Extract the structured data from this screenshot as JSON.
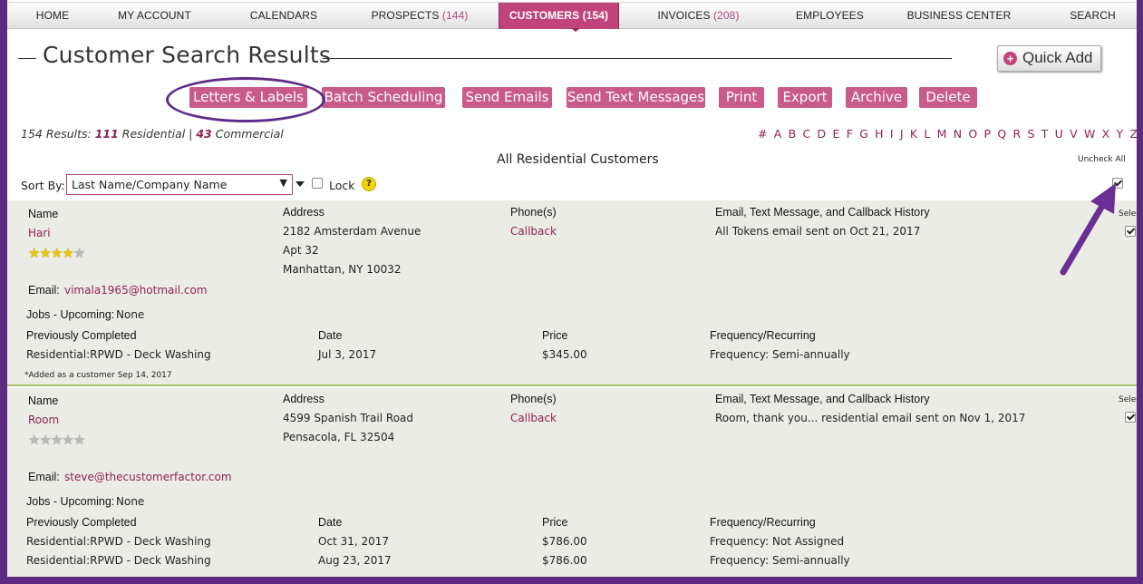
{
  "nav": {
    "items": [
      {
        "label": "HOME",
        "count": ""
      },
      {
        "label": "MY ACCOUNT",
        "count": ""
      },
      {
        "label": "CALENDARS",
        "count": ""
      },
      {
        "label": "PROSPECTS",
        "count": "(144)"
      },
      {
        "label": "CUSTOMERS",
        "count": "(154)"
      },
      {
        "label": "INVOICES",
        "count": "(208)"
      },
      {
        "label": "EMPLOYEES",
        "count": ""
      },
      {
        "label": "BUSINESS CENTER",
        "count": ""
      },
      {
        "label": "SEARCH",
        "count": ""
      }
    ],
    "active": "CUSTOMERS"
  },
  "header": {
    "title": "Customer Search Results",
    "quick_add_label": "Quick Add"
  },
  "actions": [
    "Letters & Labels",
    "Batch Scheduling",
    "Send Emails",
    "Send Text Messages",
    "Print",
    "Export",
    "Archive",
    "Delete"
  ],
  "results": {
    "prefix": "154 Results: ",
    "residential_count": "111",
    "residential_label": " Residential | ",
    "commercial_count": "43",
    "commercial_label": " Commercial"
  },
  "alphabet": [
    "#",
    "A",
    "B",
    "C",
    "D",
    "E",
    "F",
    "G",
    "H",
    "I",
    "J",
    "K",
    "L",
    "M",
    "N",
    "O",
    "P",
    "Q",
    "R",
    "S",
    "T",
    "U",
    "V",
    "W",
    "X",
    "Y",
    "Z"
  ],
  "section_heading": "All Residential Customers",
  "uncheck_all": "Uncheck All",
  "sort": {
    "label": "Sort By:",
    "value": "Last Name/Company Name",
    "lock_label": "Lock",
    "help_icon": "?"
  },
  "columns": {
    "name": "Name",
    "address": "Address",
    "phones": "Phone(s)",
    "history": "Email, Text Message, and Callback History",
    "select": "Select",
    "email_label": "Email:",
    "jobs_upcoming_label": "Jobs - Upcoming:",
    "prev_completed": "Previously Completed",
    "date": "Date",
    "price": "Price",
    "frequency": "Frequency/Recurring"
  },
  "customers": [
    {
      "name": "Hari",
      "rating": 4,
      "address": [
        "2182 Amsterdam Avenue",
        "Apt 32",
        "Manhattan, NY 10032"
      ],
      "phone": "Callback",
      "history": "All Tokens email sent on Oct 21, 2017",
      "email": "vimala1965@hotmail.com",
      "jobs_upcoming": "None",
      "jobs": [
        {
          "service": "Residential:RPWD - Deck Washing",
          "date": "Jul 3, 2017",
          "price": "$345.00",
          "frequency": "Frequency: Semi-annually"
        }
      ],
      "added_note": "*Added as a customer Sep 14, 2017",
      "selected": true
    },
    {
      "name": "Room",
      "rating": 0,
      "address": [
        "4599 Spanish Trail Road",
        "Pensacola, FL 32504"
      ],
      "phone": "Callback",
      "history": "Room, thank you... residential email sent on Nov 1, 2017",
      "email": "steve@thecustomerfactor.com",
      "jobs_upcoming": "None",
      "jobs": [
        {
          "service": "Residential:RPWD - Deck Washing",
          "date": "Oct 31, 2017",
          "price": "$786.00",
          "frequency": "Frequency: Not Assigned"
        },
        {
          "service": "Residential:RPWD - Deck Washing",
          "date": "Aug 23, 2017",
          "price": "$786.00",
          "frequency": "Frequency: Semi-annually"
        }
      ],
      "selected": true
    }
  ],
  "colors": {
    "frame": "#5d2a82",
    "accent": "#c0447a",
    "button": "#c95b8b",
    "link": "#8c2255",
    "record_bg": "#ecece6",
    "star": "#e8c600"
  },
  "icons": {
    "quick_add": "plus-circle-icon",
    "help": "question-circle-icon",
    "star": "star-icon",
    "annotation": "arrow-annotation"
  }
}
